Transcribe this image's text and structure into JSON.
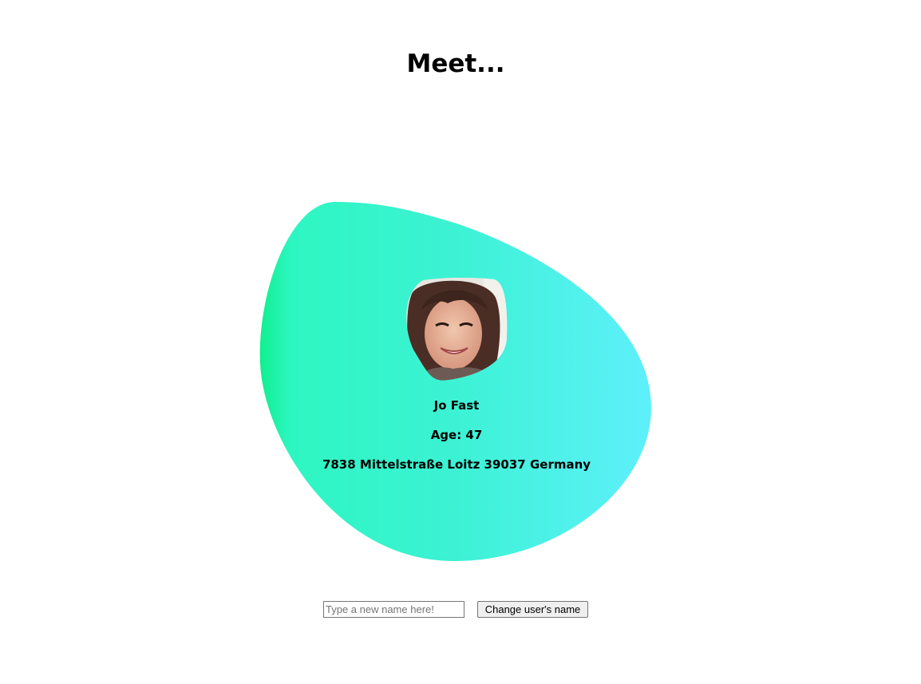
{
  "page": {
    "heading": "Meet..."
  },
  "card": {
    "gradient_start": "#0fef8f",
    "gradient_mid": "#3cf2d4",
    "gradient_end": "#5ef0fb",
    "name": "Jo Fast",
    "age_line": "Age: 47",
    "address": "7838 Mittelstraße Loitz 39037 Germany",
    "avatar_icon": "user-photo"
  },
  "form": {
    "name_input_placeholder": "Type a new name here!",
    "name_input_value": "",
    "change_button_label": "Change user's name"
  }
}
